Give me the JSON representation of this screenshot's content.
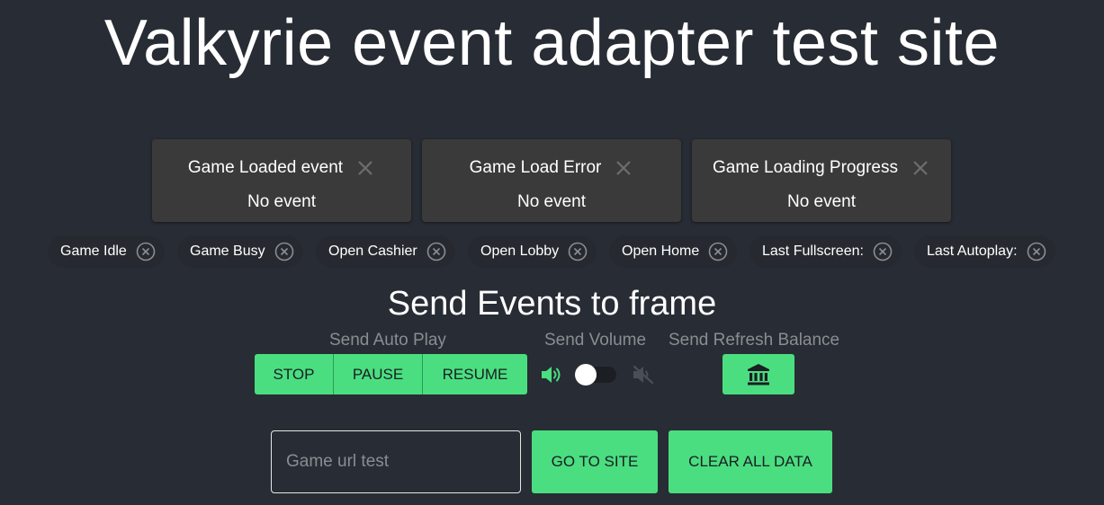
{
  "header": {
    "title": "Valkyrie event adapter test site"
  },
  "cards": [
    {
      "title": "Game Loaded event",
      "value": "No event"
    },
    {
      "title": "Game Load Error",
      "value": "No event"
    },
    {
      "title": "Game Loading Progress",
      "value": "No event"
    }
  ],
  "chips": [
    {
      "label": "Game Idle"
    },
    {
      "label": "Game Busy"
    },
    {
      "label": "Open Cashier"
    },
    {
      "label": "Open Lobby"
    },
    {
      "label": "Open Home"
    },
    {
      "label": "Last Fullscreen:"
    },
    {
      "label": "Last Autoplay:"
    }
  ],
  "send": {
    "title": "Send Events to frame",
    "auto_play_label": "Send Auto Play",
    "volume_label": "Send Volume",
    "refresh_label": "Send Refresh Balance",
    "auto_play_buttons": [
      "STOP",
      "PAUSE",
      "RESUME"
    ],
    "volume_on": false
  },
  "url_form": {
    "placeholder": "Game url test",
    "value": "",
    "go_label": "GO TO SITE",
    "clear_label": "CLEAR ALL DATA"
  },
  "colors": {
    "background": "#282c34",
    "accent": "#4ade80",
    "card": "#3a3a3a",
    "muted_text": "#8a8d91"
  },
  "icons": {
    "card_close": "close-icon",
    "chip_close": "circle-x-icon",
    "volume_on": "volume-up-icon",
    "volume_off": "volume-mute-icon",
    "refresh_balance": "bank-icon"
  }
}
